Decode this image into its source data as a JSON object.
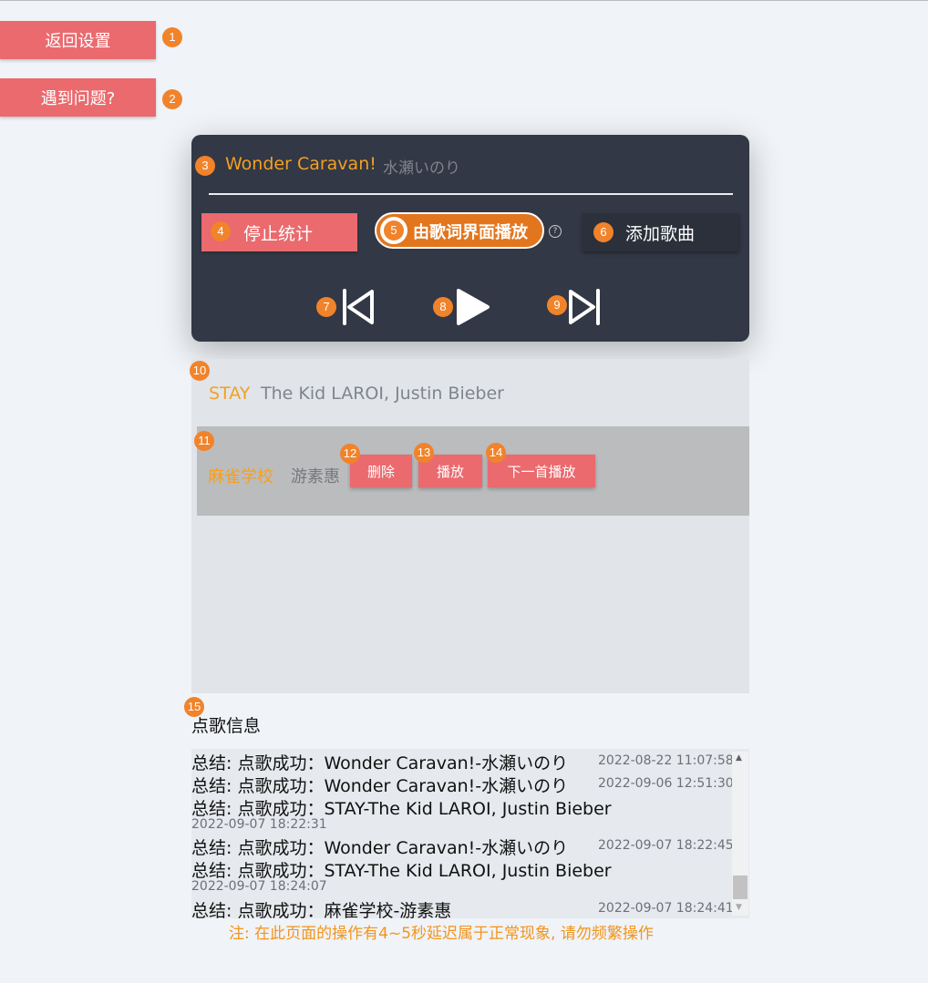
{
  "top_buttons": {
    "back_label": "返回设置",
    "help_label": "遇到问题?"
  },
  "badges": [
    "1",
    "2",
    "3",
    "4",
    "5",
    "6",
    "7",
    "8",
    "9",
    "10",
    "11",
    "12",
    "13",
    "14",
    "15"
  ],
  "player": {
    "song_title": "Wonder Caravan!",
    "song_artist": "水瀬いのり",
    "stop_label": "停止统计",
    "toggle_label": "由歌词界面播放",
    "toggle_on": true,
    "help_icon": "?",
    "add_label": "添加歌曲",
    "controls": [
      "skip-previous-icon",
      "play-icon",
      "skip-next-icon"
    ]
  },
  "queue": [
    {
      "title": "STAY",
      "artist": "The Kid LAROI, Justin Bieber"
    },
    {
      "title": "麻雀学校",
      "artist": "游素惠",
      "actions": [
        "删除",
        "播放",
        "下一首播放"
      ]
    }
  ],
  "info": {
    "title": "点歌信息",
    "log": [
      {
        "text": "总结: 点歌成功：Wonder Caravan!-水瀬いのり",
        "time": "2022-08-22 11:07:58"
      },
      {
        "text": "总结: 点歌成功：Wonder Caravan!-水瀬いのり",
        "time": "2022-09-06 12:51:30"
      },
      {
        "text": "总结: 点歌成功：STAY-The Kid LAROI, Justin Bieber",
        "time": "2022-09-07 18:22:31"
      },
      {
        "text": "总结: 点歌成功：Wonder Caravan!-水瀬いのり",
        "time": "2022-09-07 18:22:45"
      },
      {
        "text": "总结: 点歌成功：STAY-The Kid LAROI, Justin Bieber",
        "time": "2022-09-07 18:24:07"
      },
      {
        "text": "总结: 点歌成功：麻雀学校-游素惠",
        "time": "2022-09-07 18:24:41"
      }
    ],
    "note": "注: 在此页面的操作有4~5秒延迟属于正常现象, 请勿频繁操作"
  },
  "colors": {
    "accent": "#f3a023",
    "pink": "#ea6a6e",
    "badge": "#f1832b",
    "panel": "#323845",
    "toggle": "#e2761f"
  }
}
